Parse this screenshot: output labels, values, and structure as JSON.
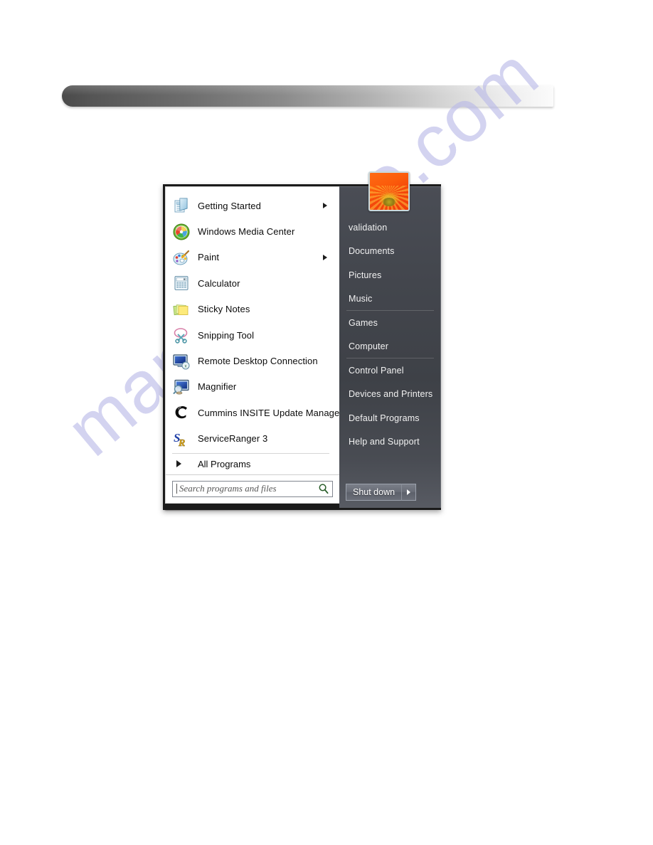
{
  "page": {
    "background_color": "#ffffff",
    "watermark_text": "manualshive.com",
    "watermark_color": "#b9b9e8"
  },
  "header_bar": {
    "name": "decorative-gradient-bar",
    "gradient_from": "#4a4a4a",
    "gradient_to": "#fbfbfb"
  },
  "start_menu": {
    "frame_color": "#1b1b1b",
    "left_pane_background": "#ffffff",
    "right_pane_background": "#43464d",
    "programs": [
      {
        "label": "Getting Started",
        "icon": "getting-started-icon",
        "has_submenu": true
      },
      {
        "label": "Windows Media Center",
        "icon": "windows-media-center-icon",
        "has_submenu": false
      },
      {
        "label": "Paint",
        "icon": "paint-icon",
        "has_submenu": true
      },
      {
        "label": "Calculator",
        "icon": "calculator-icon",
        "has_submenu": false
      },
      {
        "label": "Sticky Notes",
        "icon": "sticky-notes-icon",
        "has_submenu": false
      },
      {
        "label": "Snipping Tool",
        "icon": "snipping-tool-icon",
        "has_submenu": false
      },
      {
        "label": "Remote Desktop Connection",
        "icon": "remote-desktop-icon",
        "has_submenu": false
      },
      {
        "label": "Magnifier",
        "icon": "magnifier-icon",
        "has_submenu": false
      },
      {
        "label": "Cummins INSITE Update Manager",
        "icon": "cummins-insite-icon",
        "has_submenu": false
      },
      {
        "label": "ServiceRanger 3",
        "icon": "serviceranger-icon",
        "has_submenu": false
      }
    ],
    "all_programs": {
      "label": "All Programs",
      "icon": "right-arrow-icon"
    },
    "search": {
      "placeholder": "Search programs and files",
      "value": "",
      "icon": "search-icon"
    },
    "user": {
      "avatar_icon": "user-avatar-flower-picture"
    },
    "places": [
      {
        "label": "validation",
        "separator_after": false
      },
      {
        "label": "Documents",
        "separator_after": false
      },
      {
        "label": "Pictures",
        "separator_after": false
      },
      {
        "label": "Music",
        "separator_after": true
      },
      {
        "label": "Games",
        "separator_after": false
      },
      {
        "label": "Computer",
        "separator_after": true
      },
      {
        "label": "Control Panel",
        "separator_after": false
      },
      {
        "label": "Devices and Printers",
        "separator_after": false
      },
      {
        "label": "Default Programs",
        "separator_after": false
      },
      {
        "label": "Help and Support",
        "separator_after": false
      }
    ],
    "shutdown": {
      "label": "Shut down",
      "more_icon": "chevron-right-icon"
    }
  }
}
